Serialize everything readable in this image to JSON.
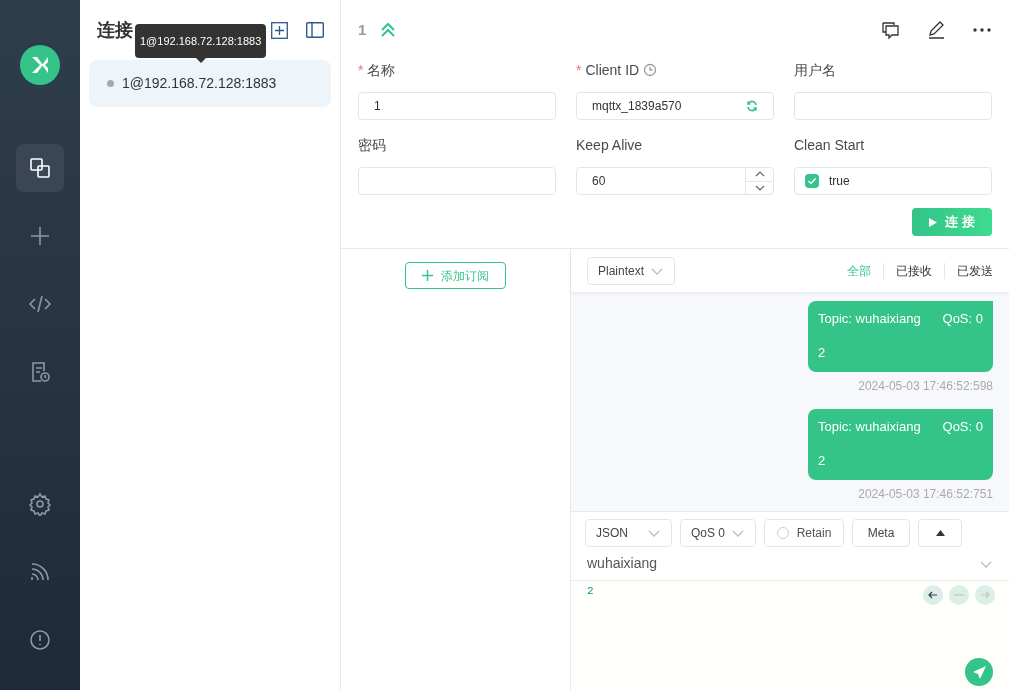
{
  "sidebar": {
    "items": [
      {
        "kind": "connections",
        "selected": true
      },
      {
        "kind": "new",
        "selected": false
      },
      {
        "kind": "script",
        "selected": false
      },
      {
        "kind": "log",
        "selected": false
      },
      {
        "kind": "settings",
        "selected": false
      },
      {
        "kind": "feed",
        "selected": false
      },
      {
        "kind": "about",
        "selected": false
      }
    ]
  },
  "connections": {
    "title": "连接",
    "tooltip": "1@192.168.72.128:1883",
    "items": [
      {
        "name": "1@192.168.72.128:1883",
        "selected": true,
        "connected": false
      }
    ]
  },
  "header": {
    "name": "1"
  },
  "form": {
    "fields": [
      {
        "kind": "text",
        "label": "名称",
        "required_mark": "*",
        "value": "1"
      },
      {
        "kind": "clientid",
        "label": "Client ID",
        "required_mark": "*",
        "value": "mqttx_1839a570"
      },
      {
        "kind": "text",
        "label": "用户名"
      },
      {
        "kind": "text",
        "label": "密码"
      },
      {
        "kind": "number",
        "label": "Keep Alive",
        "value": "60"
      },
      {
        "kind": "checkbox",
        "label": "Clean Start",
        "value": "true",
        "checked": true
      }
    ],
    "connect_button": "连 接"
  },
  "subscriptions": {
    "add_button": "添加订阅"
  },
  "messages": {
    "format": "Plaintext",
    "filters": [
      {
        "label": "全部",
        "selected": true
      },
      {
        "label": "已接收",
        "selected": false
      },
      {
        "label": "已发送",
        "selected": false
      }
    ],
    "items": [
      {
        "topic": "Topic: wuhaixiang",
        "qos": "QoS: 0",
        "payload": "2",
        "time": "2024-05-03 17:46:52:598"
      },
      {
        "topic": "Topic: wuhaixiang",
        "qos": "QoS: 0",
        "payload": "2",
        "time": "2024-05-03 17:46:52:751"
      }
    ]
  },
  "composer": {
    "format": "JSON",
    "qos": "QoS 0",
    "retain": {
      "label": "Retain",
      "checked": false
    },
    "meta": "Meta",
    "topic": "wuhaixiang",
    "payload": "2"
  }
}
